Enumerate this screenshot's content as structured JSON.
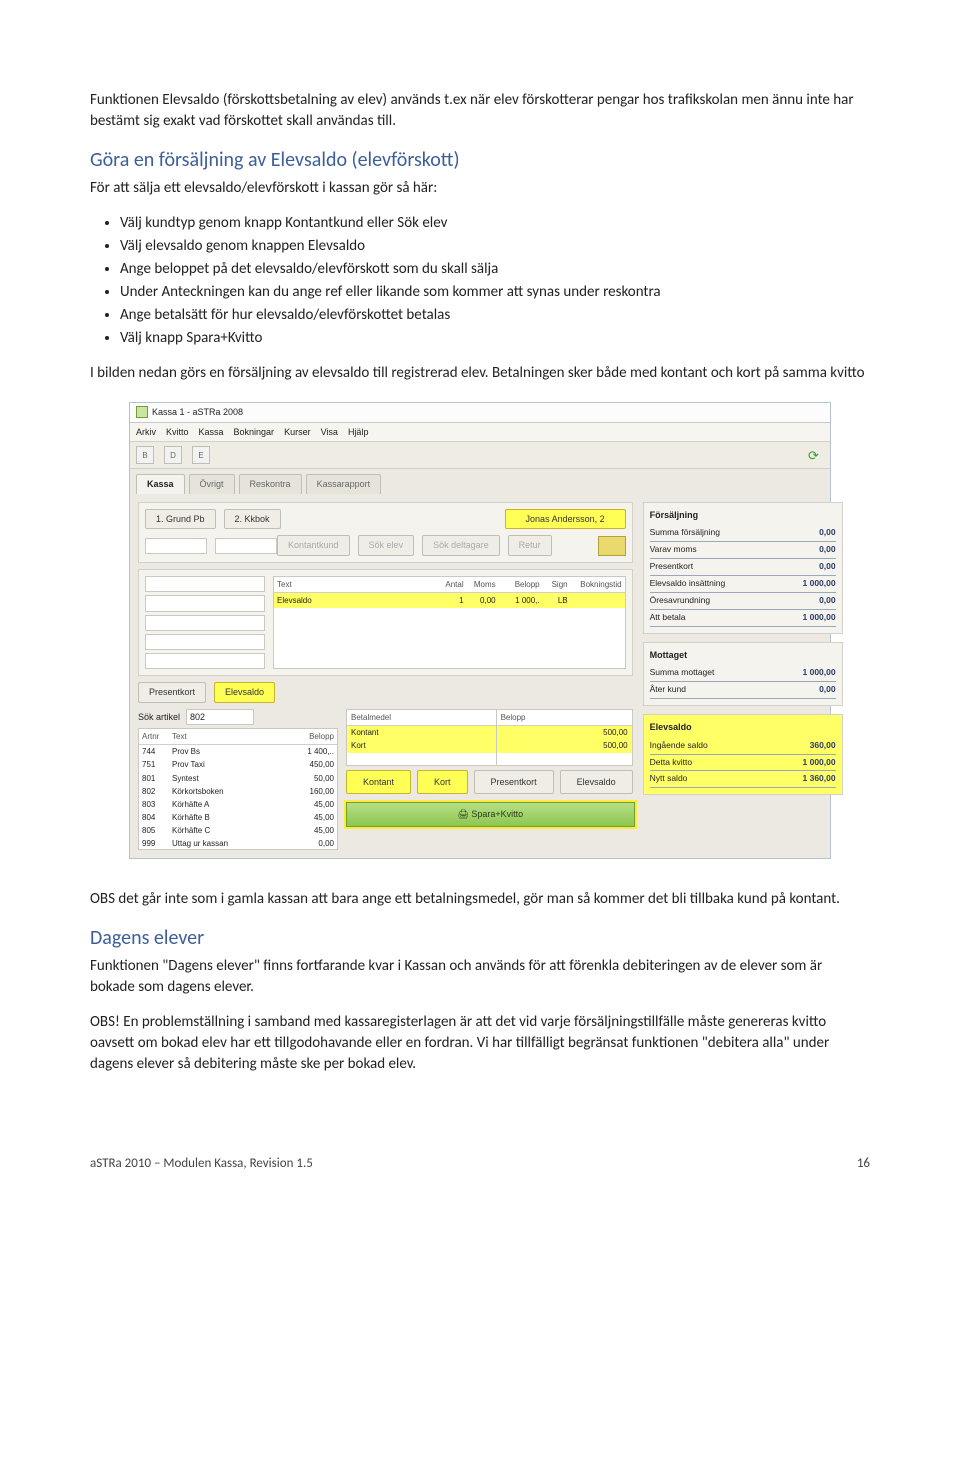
{
  "doc": {
    "intro": "Funktionen Elevsaldo (förskottsbetalning av elev) används t.ex när elev förskotterar pengar hos trafikskolan men ännu inte har bestämt sig exakt vad förskottet skall användas till.",
    "section1_title": "Göra en försäljning av Elevsaldo (elevförskott)",
    "section1_lead": "För att sälja ett elevsaldo/elevförskott i kassan gör så här:",
    "bullets": [
      "Välj kundtyp genom knapp Kontantkund eller Sök elev",
      "Välj elevsaldo genom knappen Elevsaldo",
      "Ange beloppet på det elevsaldo/elevförskott som du skall sälja",
      "Under Anteckningen kan du ange ref eller likande som kommer att synas under reskontra",
      "Ange betalsätt för hur elevsaldo/elevförskottet betalas",
      "Välj knapp Spara+Kvitto"
    ],
    "after_bullets": "I bilden nedan görs en försäljning av elevsaldo till registrerad elev. Betalningen sker både med kontant och kort på samma kvitto",
    "obs1": "OBS det går inte som i gamla kassan att bara ange ett betalningsmedel, gör man så kommer det bli tillbaka kund på kontant.",
    "section2_title": "Dagens elever",
    "section2_body": "Funktionen \"Dagens elever\" finns fortfarande kvar i Kassan och används för att förenkla debiteringen av de elever som är bokade som dagens elever.",
    "obs2": "OBS! En problemställning i samband med kassaregisterlagen är att det vid varje försäljningstillfälle måste genereras kvitto oavsett om bokad elev har ett tillgodohavande eller en fordran. Vi har tillfälligt begränsat funktionen \"debitera alla\" under dagens elever så debitering måste ske per bokad elev.",
    "footer_left": "aSTRa 2010 – Modulen Kassa, Revision 1.5",
    "footer_right": "16"
  },
  "app": {
    "title": "Kassa 1 - aSTRa 2008",
    "menu": [
      "Arkiv",
      "Kvitto",
      "Kassa",
      "Bokningar",
      "Kurser",
      "Visa",
      "Hjälp"
    ],
    "toolbar_letters": [
      "B",
      "D",
      "E"
    ],
    "tabs": [
      "Kassa",
      "Övrigt",
      "Reskontra",
      "Kassarapport"
    ],
    "grund_pb": "1. Grund Pb",
    "kkbok": "2. Kkbok",
    "customer_name": "Jonas Andersson, 2",
    "cust_buttons": [
      "Kontantkund",
      "Sök elev",
      "Sök deltagare",
      "Retur"
    ],
    "line_headers": {
      "text": "Text",
      "antal": "Antal",
      "moms": "Moms",
      "belopp": "Belopp",
      "sign": "Sign",
      "bok": "Bokningstid"
    },
    "line": {
      "text": "Elevsaldo",
      "antal": "1",
      "moms": "0,00",
      "belopp": "1 000,.",
      "sign": "LB"
    },
    "presentkort_btn": "Presentkort",
    "elevsaldo_btn": "Elevsaldo",
    "sok_artikel": "Sök artikel",
    "sok_artikel_val": "802",
    "art_head": {
      "c1": "Artnr",
      "c2": "Text",
      "c3": "Belopp"
    },
    "articles": [
      {
        "nr": "744",
        "txt": "Prov Bs",
        "bel": "1 400,.."
      },
      {
        "nr": "751",
        "txt": "Prov Taxi",
        "bel": "450,00"
      },
      {
        "nr": "801",
        "txt": "Syntest",
        "bel": "50,00"
      },
      {
        "nr": "802",
        "txt": "Körkortsboken",
        "bel": "160,00"
      },
      {
        "nr": "803",
        "txt": "Körhäfte A",
        "bel": "45,00"
      },
      {
        "nr": "804",
        "txt": "Körhäfte B",
        "bel": "45,00"
      },
      {
        "nr": "805",
        "txt": "Körhäfte C",
        "bel": "45,00"
      },
      {
        "nr": "999",
        "txt": "Uttag ur kassan",
        "bel": "0,00"
      }
    ],
    "pay_head": {
      "c1": "Betalmedel",
      "c2": "Belopp"
    },
    "pay": [
      {
        "m": "Kontant",
        "b": "500,00"
      },
      {
        "m": "Kort",
        "b": "500,00"
      }
    ],
    "pay_btns": [
      "Kontant",
      "Kort",
      "Presentkort",
      "Elevsaldo"
    ],
    "spara": "Spara+Kvitto",
    "right": {
      "forsaljning": "Försäljning",
      "r1": {
        "l": "Summa försäljning",
        "v": "0,00"
      },
      "r2": {
        "l": "Varav moms",
        "v": "0,00"
      },
      "r3": {
        "l": "Presentkort",
        "v": "0,00"
      },
      "r4": {
        "l": "Elevsaldo insättning",
        "v": "1 000,00"
      },
      "r5": {
        "l": "Öresavrundning",
        "v": "0,00"
      },
      "r6": {
        "l": "Att betala",
        "v": "1 000,00"
      },
      "mottaget": "Mottaget",
      "m1": {
        "l": "Summa mottaget",
        "v": "1 000,00"
      },
      "m2": {
        "l": "Åter kund",
        "v": "0,00"
      },
      "elevsaldo": "Elevsaldo",
      "e1": {
        "l": "Ingående saldo",
        "v": "360,00"
      },
      "e2": {
        "l": "Detta kvitto",
        "v": "1 000,00"
      },
      "e3": {
        "l": "Nytt saldo",
        "v": "1 360,00"
      }
    }
  }
}
